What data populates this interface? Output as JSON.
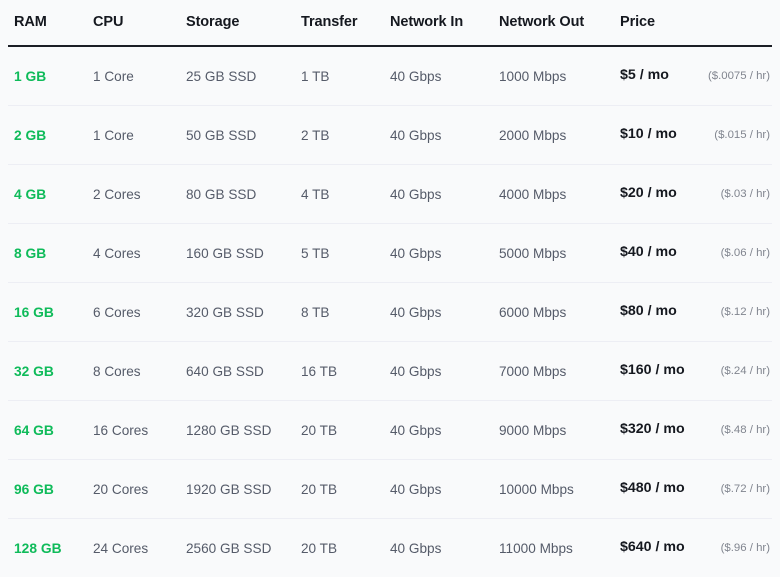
{
  "table": {
    "columns": [
      {
        "key": "ram",
        "label": "RAM"
      },
      {
        "key": "cpu",
        "label": "CPU"
      },
      {
        "key": "storage",
        "label": "Storage"
      },
      {
        "key": "transfer",
        "label": "Transfer"
      },
      {
        "key": "net_in",
        "label": "Network In"
      },
      {
        "key": "net_out",
        "label": "Network Out"
      },
      {
        "key": "price",
        "label": "Price"
      }
    ],
    "rows": [
      {
        "ram": "1 GB",
        "cpu": "1 Core",
        "storage": "25 GB SSD",
        "transfer": "1 TB",
        "net_in": "40 Gbps",
        "net_out": "1000 Mbps",
        "price_month": "$5 / mo",
        "price_hour": "($.0075 / hr)"
      },
      {
        "ram": "2 GB",
        "cpu": "1 Core",
        "storage": "50 GB SSD",
        "transfer": "2 TB",
        "net_in": "40 Gbps",
        "net_out": "2000 Mbps",
        "price_month": "$10 / mo",
        "price_hour": "($.015 / hr)"
      },
      {
        "ram": "4 GB",
        "cpu": "2 Cores",
        "storage": "80 GB SSD",
        "transfer": "4 TB",
        "net_in": "40 Gbps",
        "net_out": "4000 Mbps",
        "price_month": "$20 / mo",
        "price_hour": "($.03 / hr)"
      },
      {
        "ram": "8 GB",
        "cpu": "4 Cores",
        "storage": "160 GB SSD",
        "transfer": "5 TB",
        "net_in": "40 Gbps",
        "net_out": "5000 Mbps",
        "price_month": "$40 / mo",
        "price_hour": "($.06 / hr)"
      },
      {
        "ram": "16 GB",
        "cpu": "6 Cores",
        "storage": "320 GB SSD",
        "transfer": "8 TB",
        "net_in": "40 Gbps",
        "net_out": "6000 Mbps",
        "price_month": "$80 / mo",
        "price_hour": "($.12 / hr)"
      },
      {
        "ram": "32 GB",
        "cpu": "8 Cores",
        "storage": "640 GB SSD",
        "transfer": "16 TB",
        "net_in": "40 Gbps",
        "net_out": "7000 Mbps",
        "price_month": "$160 / mo",
        "price_hour": "($.24 / hr)"
      },
      {
        "ram": "64 GB",
        "cpu": "16 Cores",
        "storage": "1280 GB SSD",
        "transfer": "20 TB",
        "net_in": "40 Gbps",
        "net_out": "9000 Mbps",
        "price_month": "$320 / mo",
        "price_hour": "($.48 / hr)"
      },
      {
        "ram": "96 GB",
        "cpu": "20 Cores",
        "storage": "1920 GB SSD",
        "transfer": "20 TB",
        "net_in": "40 Gbps",
        "net_out": "10000 Mbps",
        "price_month": "$480 / mo",
        "price_hour": "($.72 / hr)"
      },
      {
        "ram": "128 GB",
        "cpu": "24 Cores",
        "storage": "2560 GB SSD",
        "transfer": "20 TB",
        "net_in": "40 Gbps",
        "net_out": "11000 Mbps",
        "price_month": "$640 / mo",
        "price_hour": "($.96 / hr)"
      }
    ]
  },
  "colors": {
    "ram_green": "#0fbb5a",
    "header_text": "#15181f",
    "header_rule": "#1b1e25",
    "body_text": "#555b69",
    "muted_text": "#81858f",
    "row_divider": "#edeef4",
    "background": "#f9fafb"
  }
}
